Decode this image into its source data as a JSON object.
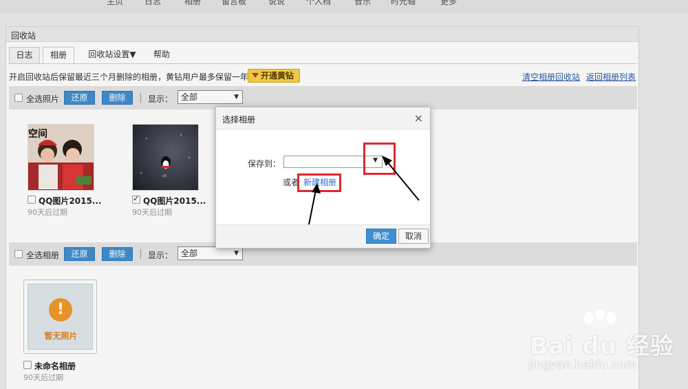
{
  "topnav": {
    "items": [
      "主页",
      "日志",
      "相册",
      "留言板",
      "说说",
      "个人档",
      "音乐",
      "时光轴",
      "更多"
    ]
  },
  "panel": {
    "title": "回收站",
    "tabs": [
      {
        "label": "日志",
        "active": false
      },
      {
        "label": "相册",
        "active": true
      },
      {
        "label": "回收站设置▼",
        "active": false
      },
      {
        "label": "帮助",
        "active": false
      }
    ],
    "notice": "开启回收站后保留最近三个月删除的相册，黄钻用户最多保留一年",
    "vip_button": "开通黄钻",
    "links": {
      "clear": "清空相册回收站",
      "back": "返回相册列表"
    }
  },
  "photo_toolbar": {
    "select_all": "全选照片",
    "restore": "还原",
    "delete": "删除",
    "show_label": "显示：",
    "show_value": "全部"
  },
  "photos": [
    {
      "caption": "QQ图片2015...",
      "expiry": "90天后过期",
      "checked": false,
      "thumb_text": "空间"
    },
    {
      "caption": "QQ图片2015...",
      "expiry": "90天后过期",
      "checked": true,
      "thumb_text": ""
    }
  ],
  "album_toolbar": {
    "select_all": "全选相册",
    "restore": "还原",
    "delete": "删除",
    "show_label": "显示：",
    "show_value": "全部"
  },
  "album": {
    "placeholder": "暂无照片",
    "name": "未命名相册",
    "expiry": "90天后过期"
  },
  "dialog": {
    "title": "选择相册",
    "close": "×",
    "save_to_label": "保存到：",
    "save_to_value": "",
    "or_label": "或者",
    "new_album": "新建相册",
    "ok": "确定",
    "cancel": "取消"
  },
  "watermark": {
    "logo": "Bai du 经验",
    "url": "jingyan.baidu.com"
  },
  "colors": {
    "primary_button": "#3f8fd2",
    "vip_button": "#f6d24a",
    "link": "#2b5aa6",
    "annotation_red": "#e0262e"
  }
}
